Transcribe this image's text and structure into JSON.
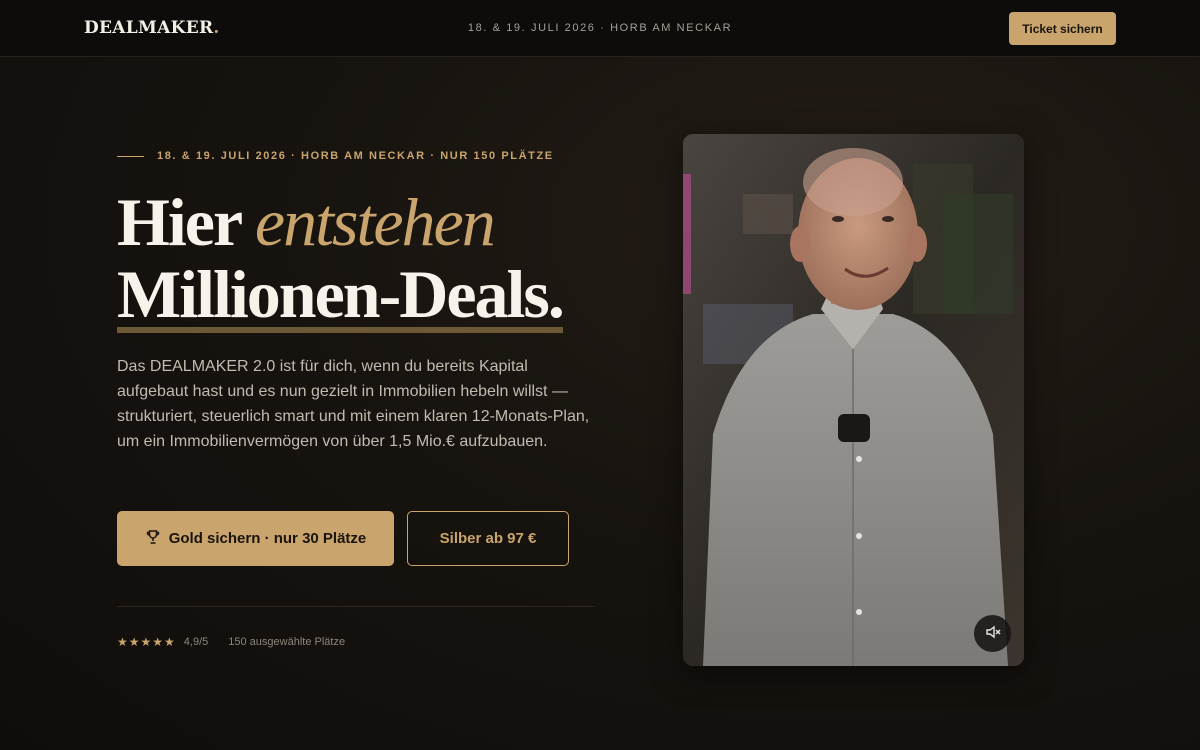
{
  "nav": {
    "logo": "DEALMAKER",
    "logo_dot": ".",
    "event_info": "18. & 19. JULI 2026 · HORB AM NECKAR",
    "cta": "Ticket sichern"
  },
  "hero": {
    "eyebrow": "18. & 19. JULI 2026 · HORB AM NECKAR · NUR 150 PLÄTZE",
    "headline_word1": "Hier",
    "headline_accent": "entstehen",
    "headline_line2": "Millionen-Deals.",
    "lead": "Das DEALMAKER 2.0 ist für dich, wenn du bereits Kapital aufgebaut hast und es nun gezielt in Immobilien hebeln willst — strukturiert, steuerlich smart und mit einem klaren 12-Monats-Plan, um ein Immobilienvermögen von über 1,5 Mio.€ aufzubauen.",
    "primary_button": "Gold sichern · nur 30 Plätze",
    "secondary_button": "Silber ab 97 €",
    "stars": "★★★★★",
    "rating": "4,9/5",
    "seats_note": "150 ausgewählte Plätze"
  },
  "icons": {
    "primary_button_icon": "trophy-icon",
    "mute_icon": "speaker-muted-icon"
  },
  "colors": {
    "accent": "#c9a46c",
    "background": "#17130f",
    "nav_background": "#0d0c0b"
  }
}
